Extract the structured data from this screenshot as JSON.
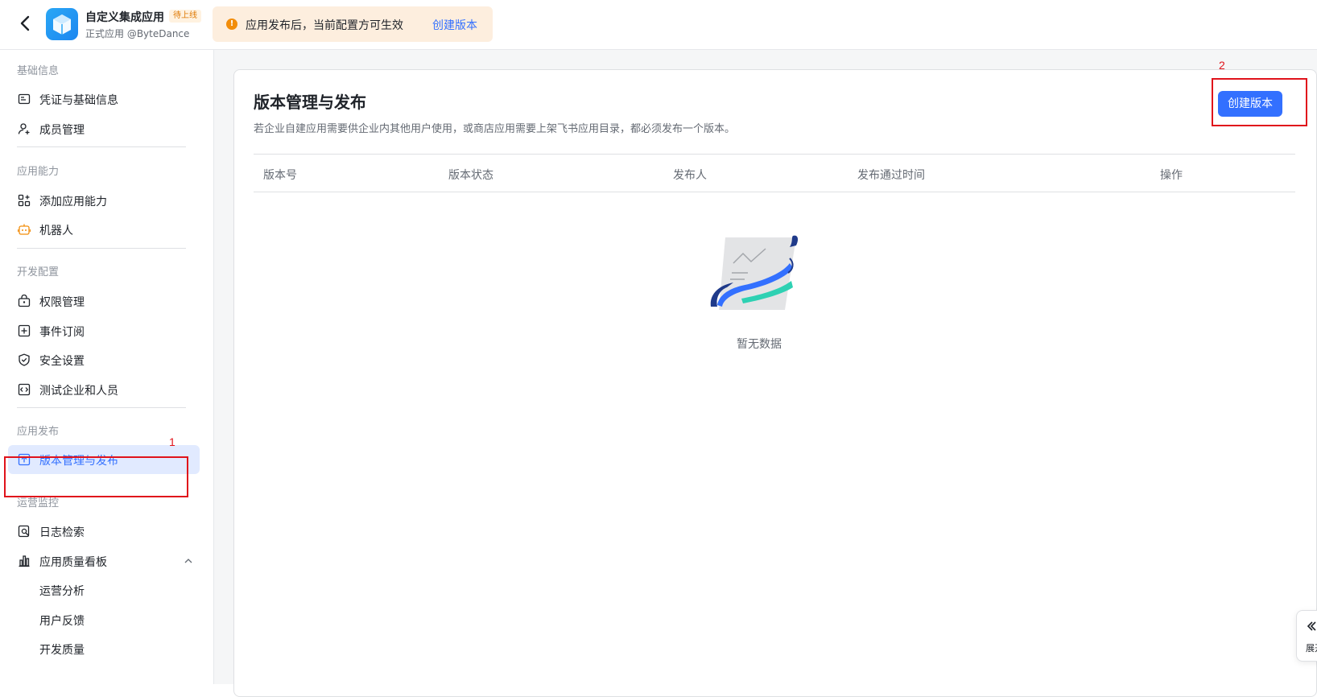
{
  "header": {
    "app_name": "自定义集成应用",
    "badge": "待上线",
    "app_sub": "正式应用 @ByteDance",
    "notice_text": "应用发布后，当前配置方可生效",
    "notice_link": "创建版本"
  },
  "sidebar": {
    "sections": [
      {
        "title": "基础信息",
        "items": [
          "凭证与基础信息",
          "成员管理"
        ]
      },
      {
        "title": "应用能力",
        "items": [
          "添加应用能力",
          "机器人"
        ]
      },
      {
        "title": "开发配置",
        "items": [
          "权限管理",
          "事件订阅",
          "安全设置",
          "测试企业和人员"
        ]
      },
      {
        "title": "应用发布",
        "items": [
          "版本管理与发布"
        ]
      },
      {
        "title": "运营监控",
        "items": [
          "日志检索",
          "应用质量看板"
        ]
      }
    ],
    "sub_items": [
      "运营分析",
      "用户反馈",
      "开发质量"
    ],
    "active_item": "版本管理与发布"
  },
  "main": {
    "title": "版本管理与发布",
    "description": "若企业自建应用需要供企业内其他用户使用，或商店应用需要上架飞书应用目录，都必须发布一个版本。",
    "create_button": "创建版本",
    "columns": [
      "版本号",
      "版本状态",
      "发布人",
      "发布通过时间",
      "操作"
    ],
    "empty_text": "暂无数据"
  },
  "annotations": {
    "first": "1",
    "second": "2"
  },
  "float_tab": {
    "label": "展开"
  },
  "colors": {
    "accent": "#3370ff",
    "annotation": "#e0131b",
    "notice_bg": "#fdeede"
  }
}
